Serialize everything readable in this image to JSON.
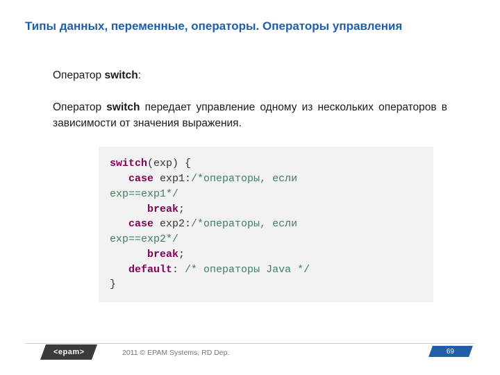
{
  "title": "Типы данных, переменные, операторы. Операторы управления",
  "p1_pre": "Оператор ",
  "p1_kw": "switch",
  "p1_post": ":",
  "p2_pre": "Оператор ",
  "p2_kw": "switch",
  "p2_post": " передает управление одному из нескольких операторов в зависимости от  значения выражения.",
  "code": {
    "l1_k": "switch",
    "l1_t": "(exp) {",
    "l2_k": "case",
    "l2_t1": " exp1:",
    "l2_c": "/*операторы, если",
    "l3_c": "exp==exp1*/",
    "l4_k": "break",
    "l4_t": ";",
    "l5_k": "case",
    "l5_t1": " exp2:",
    "l5_c": "/*операторы, если",
    "l6_c": "exp==exp2*/",
    "l7_k": "break",
    "l7_t": ";",
    "l8_k": "default",
    "l8_t": ": ",
    "l8_c": "/* операторы Java */",
    "l9_t": "}"
  },
  "footer": {
    "logo": "<epam>",
    "copyright": "2011 © EPAM Systems, RD Dep.",
    "page": "69"
  }
}
